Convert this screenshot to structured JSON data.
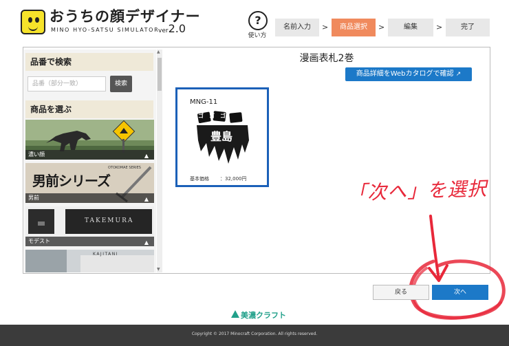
{
  "header": {
    "logo_title": "おうちの顔デザイナー",
    "logo_subtitle": "MINO HYO-SATSU SIMULATOR",
    "logo_version_prefix": "ver",
    "logo_version_number": "2.0",
    "help_symbol": "?",
    "help_label": "使い方"
  },
  "steps": [
    {
      "label": "名前入力",
      "active": false
    },
    {
      "label": "商品選択",
      "active": true
    },
    {
      "label": "編集",
      "active": false
    },
    {
      "label": "完了",
      "active": false
    }
  ],
  "sidebar": {
    "search_heading": "品番で検索",
    "search_placeholder": "品番（部分一致）",
    "search_button": "検索",
    "categories_heading": "商品を選ぶ",
    "categories": [
      {
        "label": "濃い顔"
      },
      {
        "label": "男前"
      },
      {
        "label": "モデスト"
      },
      {
        "label": ""
      }
    ],
    "category_image_texts": {
      "otokomae_series": "OTOKOMAE SERIES",
      "otokomae_title": "男前シリーズ",
      "takemura": "TAKEMURA",
      "kajitani": "KAJITANI"
    }
  },
  "main": {
    "title": "漫画表札2巻",
    "catalog_button": "商品詳細をWebカタログで確認",
    "product": {
      "code": "MNG-11",
      "name_on_plate": "豊島",
      "sound_effect": "ゴゴゴ",
      "price_label": "基本価格",
      "price_value": "：32,000円"
    }
  },
  "annotation_text": "「次へ」を選択",
  "buttons": {
    "back": "戻る",
    "next": "次へ"
  },
  "brand": "美濃クラフト",
  "footer": "Copyright © 2017 Minocraft Corporation. All rights reserved.",
  "colors": {
    "accent_blue": "#1c79c8",
    "active_step": "#f08a5d",
    "annotation_red": "#e8283a",
    "brand_green": "#21a08a",
    "logo_yellow": "#f6e32a"
  }
}
